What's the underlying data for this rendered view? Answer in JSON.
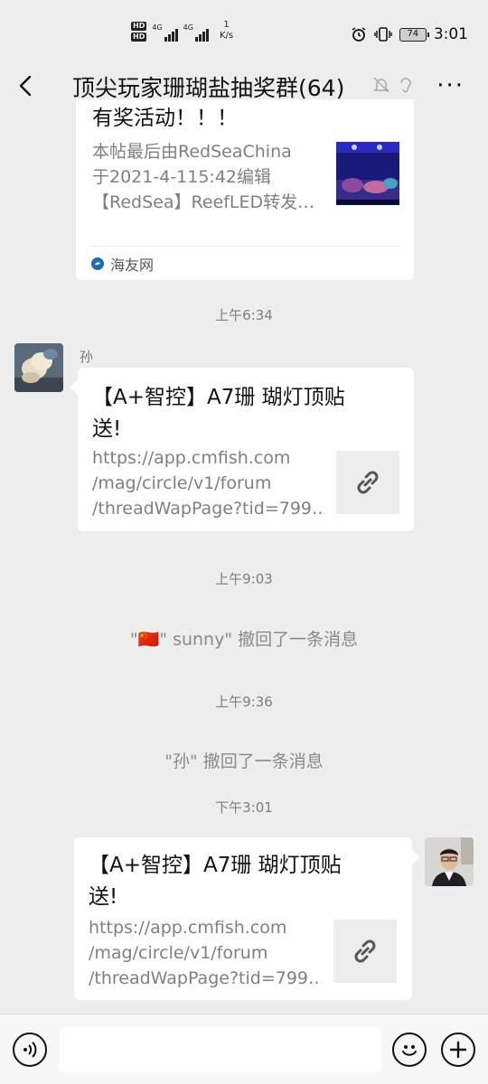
{
  "status": {
    "hd1": "HD",
    "hd2": "HD",
    "sig1": "4G",
    "sig2": "4G",
    "net_speed": "1",
    "net_unit": "K/s",
    "battery": "74",
    "time": "3:01",
    "alarm_icon": "alarm-icon",
    "vibrate_icon": "vibrate-icon"
  },
  "nav": {
    "title": "顶尖玩家珊瑚盐抽奖群(64)",
    "mute_icon": "bell-off-icon",
    "ear_icon": "ear-icon",
    "more": "···"
  },
  "messages": {
    "card1": {
      "title_line1": "有奖活动！！！",
      "desc1": "本帖最后由RedSeaChina",
      "desc2": "于2021-4-115:42编辑",
      "desc3": "【RedSea】ReefLED转发…",
      "source": "海友网"
    },
    "time1": "上午6:34",
    "msg2": {
      "sender": "孙",
      "title1": "【A+智控】A7珊 瑚灯顶贴",
      "title2": "送!",
      "desc1": "https://app.cmfish.com",
      "desc2": "/mag/circle/v1/forum",
      "desc3": "/threadWapPage?tid=799…"
    },
    "time2": "上午9:03",
    "recall1_flag": "🇨🇳",
    "recall1": "\" sunny\" 撤回了一条消息",
    "recall1_prefix": "\"",
    "time3": "上午9:36",
    "recall2": "\"孙\" 撤回了一条消息",
    "time4": "下午3:01",
    "msg3": {
      "title1": "【A+智控】A7珊 瑚灯顶贴",
      "title2": "送!",
      "desc1": "https://app.cmfish.com",
      "desc2": "/mag/circle/v1/forum",
      "desc3": "/threadWapPage?tid=799…"
    }
  },
  "input": {
    "placeholder": ""
  }
}
